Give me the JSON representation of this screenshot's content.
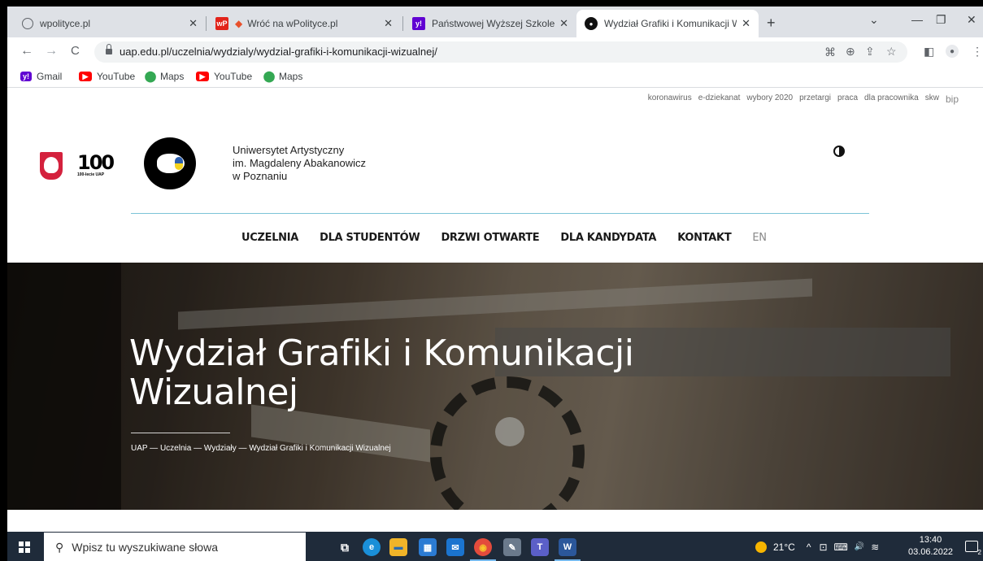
{
  "browser": {
    "tabs": [
      {
        "title": "wpolityce.pl",
        "icon": "globe-icon",
        "close": "✕"
      },
      {
        "title": "Wróć na wPolityce.pl",
        "icon": "wpolityce-icon",
        "close": "✕"
      },
      {
        "title": "Państwowej Wyższej Szkole Sztuk",
        "icon": "yahoo-icon",
        "close": "✕"
      },
      {
        "title": "Wydział Grafiki i Komunikacji Wiz",
        "icon": "uap-icon",
        "close": "✕",
        "active": true
      }
    ],
    "new_tab": "+",
    "controls": {
      "chevron": "⌄",
      "minimize": "—",
      "restore": "❐",
      "close": "✕"
    },
    "nav": {
      "back": "←",
      "forward": "→",
      "reload": "C"
    },
    "url": "uap.edu.pl/uczelnia/wydzialy/wydzial-grafiki-i-komunikacji-wizualnej/",
    "bookmarks": [
      {
        "label": "Gmail",
        "icon": "yahoo-icon",
        "icon_text": "y!",
        "color": "#6001d2"
      },
      {
        "label": "YouTube",
        "icon": "youtube-icon",
        "icon_text": "▶",
        "color": "#ff0000"
      },
      {
        "label": "Maps",
        "icon": "maps-icon",
        "icon_text": "⬤",
        "color": "#34a853"
      },
      {
        "label": "YouTube",
        "icon": "youtube-icon",
        "icon_text": "▶",
        "color": "#ff0000"
      },
      {
        "label": "Maps",
        "icon": "maps-icon",
        "icon_text": "⬤",
        "color": "#34a853"
      }
    ]
  },
  "site": {
    "utility_links": [
      "koronawirus",
      "e-dziekanat",
      "wybory 2020",
      "przetargi",
      "praca",
      "dla pracownika",
      "skw",
      "bip"
    ],
    "logo100": {
      "number": "100",
      "caption": "100-lecie UAP"
    },
    "university_name": [
      "Uniwersytet Artystyczny",
      "im. Magdaleny Abakanowicz",
      "w Poznaniu"
    ],
    "nav": [
      "UCZELNIA",
      "DLA STUDENTÓW",
      "DRZWI OTWARTE",
      "DLA KANDYDATA",
      "KONTAKT"
    ],
    "lang": "EN",
    "hero": {
      "title_line1": "Wydział Grafiki i Komunikacji",
      "title_line2": "Wizualnej",
      "breadcrumb": "UAP — Uczelnia — Wydziały — Wydział Grafiki i Komunikacji Wizualnej"
    }
  },
  "taskbar": {
    "search_placeholder": "Wpisz tu wyszukiwane słowa",
    "weather": "21°C",
    "time": "13:40",
    "date": "03.06.2022",
    "notification_count": "2",
    "apps": [
      {
        "name": "task-view-icon",
        "label": "⧉",
        "color": "#1f2b3a"
      },
      {
        "name": "edge-icon",
        "label": "e",
        "color": "#1a8fd8"
      },
      {
        "name": "file-explorer-icon",
        "label": "▬",
        "color": "#f0b429"
      },
      {
        "name": "store-icon",
        "label": "▦",
        "color": "#2b7bd3"
      },
      {
        "name": "mail-icon",
        "label": "✉",
        "color": "#1b74cf"
      },
      {
        "name": "chrome-icon",
        "label": "◉",
        "color": "#e34b3c"
      },
      {
        "name": "paint-icon",
        "label": "✎",
        "color": "#6b7a8c"
      },
      {
        "name": "teams-icon",
        "label": "T",
        "color": "#5b5fc7"
      },
      {
        "name": "word-icon",
        "label": "W",
        "color": "#2b579a"
      }
    ],
    "tray_icons": [
      "^",
      "⊡",
      "⌨",
      "🔊",
      "≋"
    ]
  }
}
